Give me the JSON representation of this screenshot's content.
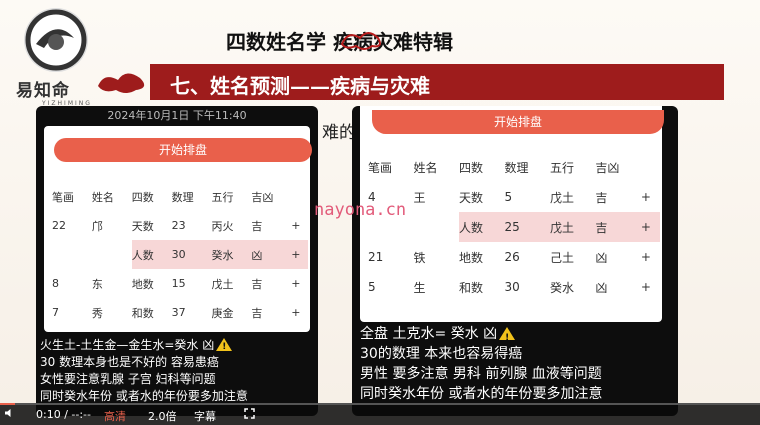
{
  "slide": {
    "logo_text": "易知命",
    "logo_sub": "YIZHIMING",
    "top_title": "四数姓名学  疾病灾难特辑",
    "banner_title": "七、姓名预测——疾病与灾难",
    "hidden_text": "难的"
  },
  "phone1": {
    "status_date": "2024年10月1日 下午11:40",
    "button_label": "开始排盘",
    "headers": [
      "笔画",
      "姓名",
      "四数",
      "数理",
      "五行",
      "吉凶"
    ],
    "rows": [
      {
        "c0": "22",
        "c1": "邝",
        "c2": "天数",
        "c3": "23",
        "c4": "丙火",
        "c5": "吉",
        "plus": "+"
      },
      {
        "c0": "",
        "c1": "",
        "c2": "人数",
        "c3": "30",
        "c4": "癸水",
        "c5": "凶",
        "plus": "+"
      },
      {
        "c0": "8",
        "c1": "东",
        "c2": "地数",
        "c3": "15",
        "c4": "戊土",
        "c5": "吉",
        "plus": "+"
      },
      {
        "c0": "7",
        "c1": "秀",
        "c2": "和数",
        "c3": "37",
        "c4": "庚金",
        "c5": "吉",
        "plus": "+"
      }
    ],
    "lines": [
      "火生土-土生金—金生水=癸水 凶",
      "30 数理本身也是不好的 容易患癌",
      "女性要注意乳腺 子宫 妇科等问题",
      "同时癸水年份 或者水的年份要多加注意"
    ]
  },
  "phone2": {
    "button_label": "开始排盘",
    "headers": [
      "笔画",
      "姓名",
      "四数",
      "数理",
      "五行",
      "吉凶"
    ],
    "rows": [
      {
        "c0": "4",
        "c1": "王",
        "c2": "天数",
        "c3": "5",
        "c4": "戊土",
        "c5": "吉",
        "plus": "+"
      },
      {
        "c0": "",
        "c1": "",
        "c2": "人数",
        "c3": "25",
        "c4": "戊土",
        "c5": "吉",
        "plus": "+"
      },
      {
        "c0": "21",
        "c1": "铁",
        "c2": "地数",
        "c3": "26",
        "c4": "己土",
        "c5": "凶",
        "plus": "+"
      },
      {
        "c0": "5",
        "c1": "生",
        "c2": "和数",
        "c3": "30",
        "c4": "癸水",
        "c5": "凶",
        "plus": "+"
      }
    ],
    "lines": [
      "全盘 土克水= 癸水 凶",
      "30的数理 本来也容易得癌",
      "男性 要多注意 男科 前列腺 血液等问题",
      "同时癸水年份 或者水的年份要多加注意"
    ]
  },
  "watermark": "nayona.cn",
  "player": {
    "time": "0:10 / --:--",
    "quality": "高清",
    "speed": "2.0倍",
    "subtitles": "字幕"
  },
  "colors": {
    "banner": "#9e1c1c",
    "button": "#e9604b",
    "highlight": "#f7d7d7"
  }
}
